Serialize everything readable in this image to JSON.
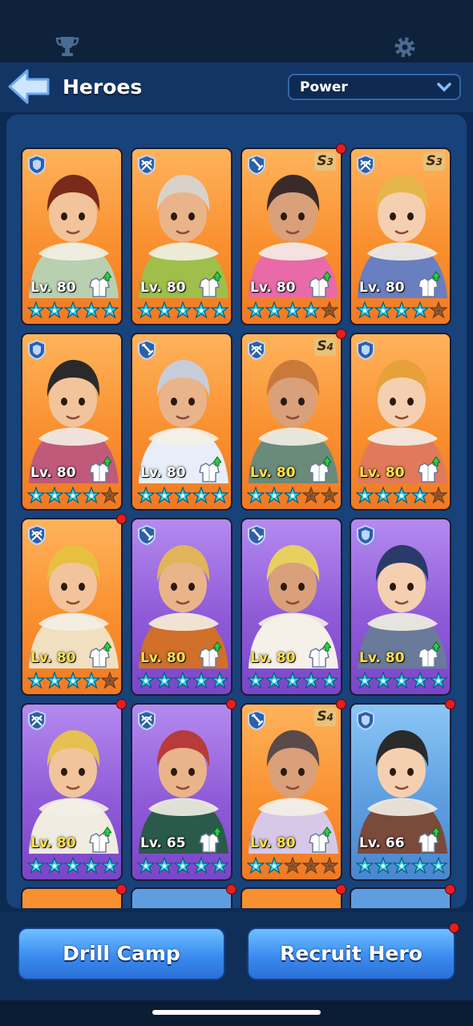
{
  "header": {
    "title": "Heroes",
    "sort_label": "Power"
  },
  "colors": {
    "orange": "#f9902f",
    "purple": "#8f5bd8",
    "blue": "#5e9ee0",
    "accent": "#3b8cf0",
    "star": "#36d0e8"
  },
  "heroes": [
    {
      "level": "Lv. 80",
      "role": "shield-icon",
      "bg": "orange",
      "stars": 5,
      "gold_level": false,
      "grade": "",
      "dot": false
    },
    {
      "level": "Lv. 80",
      "role": "crossbow-icon",
      "bg": "orange",
      "stars": 5,
      "gold_level": false,
      "grade": "",
      "dot": false
    },
    {
      "level": "Lv. 80",
      "role": "sword-icon",
      "bg": "orange",
      "stars": 4,
      "gold_level": false,
      "grade": "S",
      "grade_num": "3",
      "dot": true
    },
    {
      "level": "Lv. 80",
      "role": "crossbow-icon",
      "bg": "orange",
      "stars": 4,
      "gold_level": false,
      "grade": "S",
      "grade_num": "3",
      "dot": false
    },
    {
      "level": "Lv. 80",
      "role": "shield-icon",
      "bg": "orange",
      "stars": 4,
      "gold_level": false,
      "grade": "",
      "dot": false
    },
    {
      "level": "Lv. 80",
      "role": "sword-icon",
      "bg": "orange",
      "stars": 5,
      "gold_level": false,
      "grade": "",
      "dot": false
    },
    {
      "level": "Lv. 80",
      "role": "crossbow-icon",
      "bg": "orange",
      "stars": 3,
      "gold_level": true,
      "grade": "S",
      "grade_num": "4",
      "dot": true
    },
    {
      "level": "Lv. 80",
      "role": "shield-icon",
      "bg": "orange",
      "stars": 4,
      "gold_level": true,
      "grade": "",
      "dot": false
    },
    {
      "level": "Lv. 80",
      "role": "crossbow-icon",
      "bg": "orange",
      "stars": 4,
      "gold_level": true,
      "grade": "",
      "dot": true
    },
    {
      "level": "Lv. 80",
      "role": "sword-icon",
      "bg": "purple",
      "stars": 5,
      "gold_level": true,
      "grade": "",
      "dot": false
    },
    {
      "level": "Lv. 80",
      "role": "sword-icon",
      "bg": "purple",
      "stars": 5,
      "gold_level": true,
      "grade": "",
      "dot": false
    },
    {
      "level": "Lv. 80",
      "role": "shield-icon",
      "bg": "purple",
      "stars": 5,
      "gold_level": true,
      "grade": "",
      "dot": false
    },
    {
      "level": "Lv. 80",
      "role": "crossbow-icon",
      "bg": "purple",
      "stars": 5,
      "gold_level": true,
      "grade": "",
      "dot": true
    },
    {
      "level": "Lv. 65",
      "role": "crossbow-icon",
      "bg": "purple",
      "stars": 5,
      "gold_level": false,
      "grade": "",
      "dot": true
    },
    {
      "level": "Lv. 80",
      "role": "sword-icon",
      "bg": "orange",
      "stars": 2,
      "gold_level": true,
      "grade": "S",
      "grade_num": "4",
      "dot": true
    },
    {
      "level": "Lv. 66",
      "role": "shield-icon",
      "bg": "blue",
      "stars": 5,
      "gold_level": false,
      "grade": "",
      "dot": true
    }
  ],
  "buttons": {
    "drill_camp": "Drill Camp",
    "recruit_hero": "Recruit Hero"
  }
}
